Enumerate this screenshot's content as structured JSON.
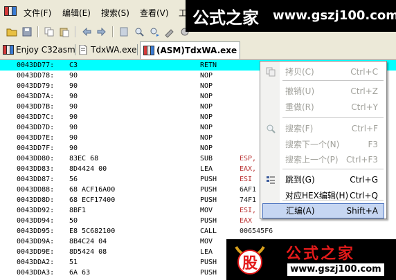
{
  "menubar": {
    "items": [
      "文件(F)",
      "编辑(E)",
      "搜索(S)",
      "查看(V)",
      "工"
    ]
  },
  "tabs": [
    {
      "label": "Enjoy C32asm"
    },
    {
      "label": "TdxWA.exe"
    },
    {
      "label": "(ASM)TdxWA.exe"
    }
  ],
  "code_rows": [
    {
      "addr": "0043DD77:",
      "hex": "C3",
      "mnem": "RETN",
      "op": ""
    },
    {
      "addr": "0043DD78:",
      "hex": "90",
      "mnem": "NOP",
      "op": ""
    },
    {
      "addr": "0043DD79:",
      "hex": "90",
      "mnem": "NOP",
      "op": ""
    },
    {
      "addr": "0043DD7A:",
      "hex": "90",
      "mnem": "NOP",
      "op": ""
    },
    {
      "addr": "0043DD7B:",
      "hex": "90",
      "mnem": "NOP",
      "op": ""
    },
    {
      "addr": "0043DD7C:",
      "hex": "90",
      "mnem": "NOP",
      "op": ""
    },
    {
      "addr": "0043DD7D:",
      "hex": "90",
      "mnem": "NOP",
      "op": ""
    },
    {
      "addr": "0043DD7E:",
      "hex": "90",
      "mnem": "NOP",
      "op": ""
    },
    {
      "addr": "0043DD7F:",
      "hex": "90",
      "mnem": "NOP",
      "op": ""
    },
    {
      "addr": "0043DD80:",
      "hex": "83EC 68",
      "mnem": "SUB",
      "op": "ESP,"
    },
    {
      "addr": "0043DD83:",
      "hex": "8D4424 00",
      "mnem": "LEA",
      "op": "EAX,"
    },
    {
      "addr": "0043DD87:",
      "hex": "56",
      "mnem": "PUSH",
      "op": "ESI"
    },
    {
      "addr": "0043DD88:",
      "hex": "68 ACF16A00",
      "mnem": "PUSH",
      "op": "6AF1"
    },
    {
      "addr": "0043DD8D:",
      "hex": "68 ECF17400",
      "mnem": "PUSH",
      "op": "74F1"
    },
    {
      "addr": "0043DD92:",
      "hex": "8BF1",
      "mnem": "MOV",
      "op": "ESI,"
    },
    {
      "addr": "0043DD94:",
      "hex": "50",
      "mnem": "PUSH",
      "op": "EAX"
    },
    {
      "addr": "0043DD95:",
      "hex": "E8 5C682100",
      "mnem": "CALL",
      "op": "006545F6"
    },
    {
      "addr": "0043DD9A:",
      "hex": "8B4C24 04",
      "mnem": "MOV",
      "op": ""
    },
    {
      "addr": "0043DD9E:",
      "hex": "8D5424 08",
      "mnem": "LEA",
      "op": ""
    },
    {
      "addr": "0043DDA2:",
      "hex": "51",
      "mnem": "PUSH",
      "op": ""
    },
    {
      "addr": "0043DDA3:",
      "hex": "6A 63",
      "mnem": "PUSH",
      "op": ""
    }
  ],
  "context_menu": {
    "items": [
      {
        "label": "拷贝(C)",
        "key": "Ctrl+C",
        "state": "disabled",
        "icon": "copy-icon"
      },
      {
        "label": "撤销(U)",
        "key": "Ctrl+Z",
        "state": "disabled",
        "icon": ""
      },
      {
        "label": "重做(R)",
        "key": "Ctrl+Y",
        "state": "disabled",
        "icon": ""
      },
      {
        "label": "搜索(F)",
        "key": "Ctrl+F",
        "state": "disabled",
        "icon": "search-icon"
      },
      {
        "label": "搜索下一个(N)",
        "key": "F3",
        "state": "disabled",
        "icon": ""
      },
      {
        "label": "搜索上一个(P)",
        "key": "Ctrl+F3",
        "state": "disabled",
        "icon": ""
      },
      {
        "label": "跳到(G)",
        "key": "Ctrl+G",
        "state": "enabled",
        "icon": "goto-icon"
      },
      {
        "label": "对应HEX编辑(H)",
        "key": "Ctrl+Q",
        "state": "enabled",
        "icon": ""
      },
      {
        "label": "汇编(A)",
        "key": "Shift+A",
        "state": "highlighted",
        "icon": ""
      }
    ]
  },
  "watermark_top": {
    "brand": "公式之家",
    "url": "www.gszj100.com"
  },
  "watermark_bottom": {
    "logo_char": "股",
    "brand": "公式之家",
    "url": "www.gszj100.com"
  },
  "colors": {
    "selection": "#00ffff",
    "menu_highlight": "#c6d6f2",
    "operand_red": "#b83030",
    "chrome": "#ece9d8"
  }
}
